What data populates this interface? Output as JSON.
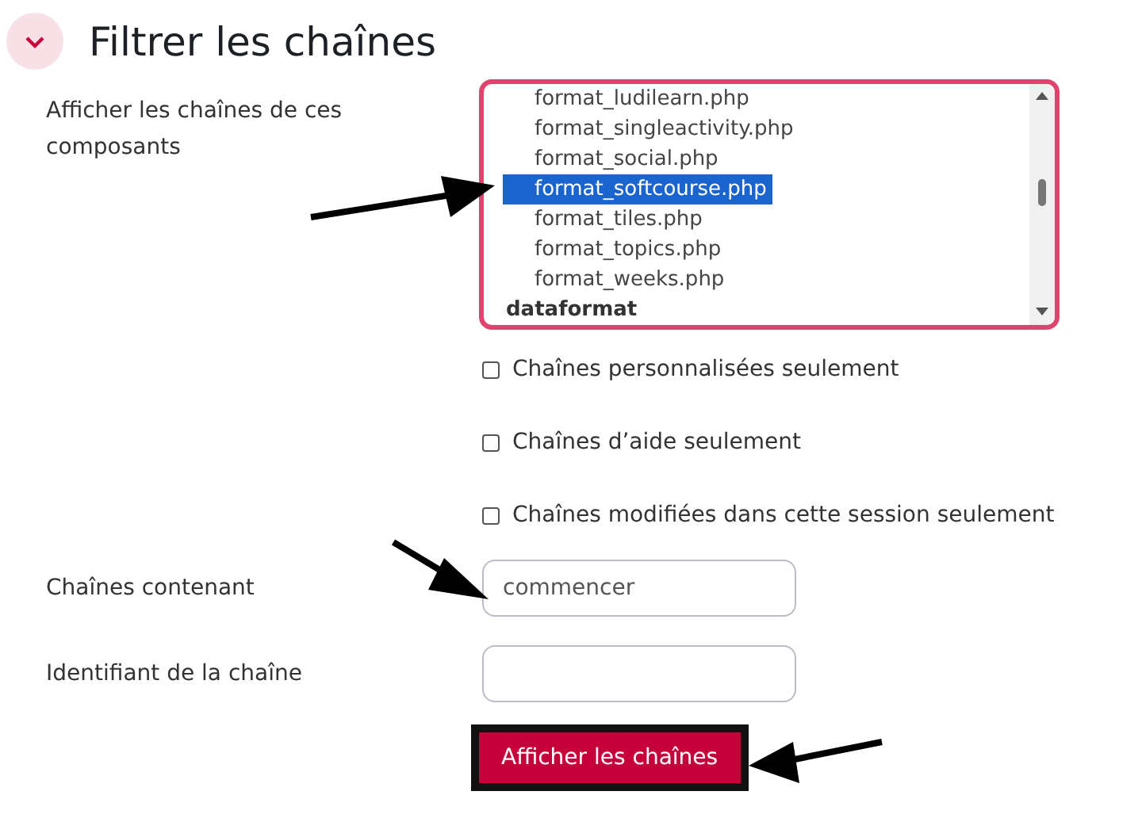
{
  "section": {
    "title": "Filtrer les chaînes",
    "expanded": true
  },
  "components": {
    "label": "Afficher les chaînes de ces composants",
    "items": [
      {
        "kind": "option",
        "text": "format_ludilearn.php",
        "selected": false
      },
      {
        "kind": "option",
        "text": "format_singleactivity.php",
        "selected": false
      },
      {
        "kind": "option",
        "text": "format_social.php",
        "selected": false
      },
      {
        "kind": "option",
        "text": "format_softcourse.php",
        "selected": true
      },
      {
        "kind": "option",
        "text": "format_tiles.php",
        "selected": false
      },
      {
        "kind": "option",
        "text": "format_topics.php",
        "selected": false
      },
      {
        "kind": "option",
        "text": "format_weeks.php",
        "selected": false
      },
      {
        "kind": "group",
        "text": "dataformat",
        "selected": false
      }
    ]
  },
  "checkboxes": [
    {
      "label": "Chaînes personnalisées seulement",
      "checked": false
    },
    {
      "label": "Chaînes d’aide seulement",
      "checked": false
    },
    {
      "label": "Chaînes modifiées dans cette session seulement",
      "checked": false
    }
  ],
  "fields": [
    {
      "label": "Chaînes contenant",
      "value": "commencer"
    },
    {
      "label": "Identifiant de la chaîne"
    }
  ],
  "button": "Afficher les chaînes"
}
